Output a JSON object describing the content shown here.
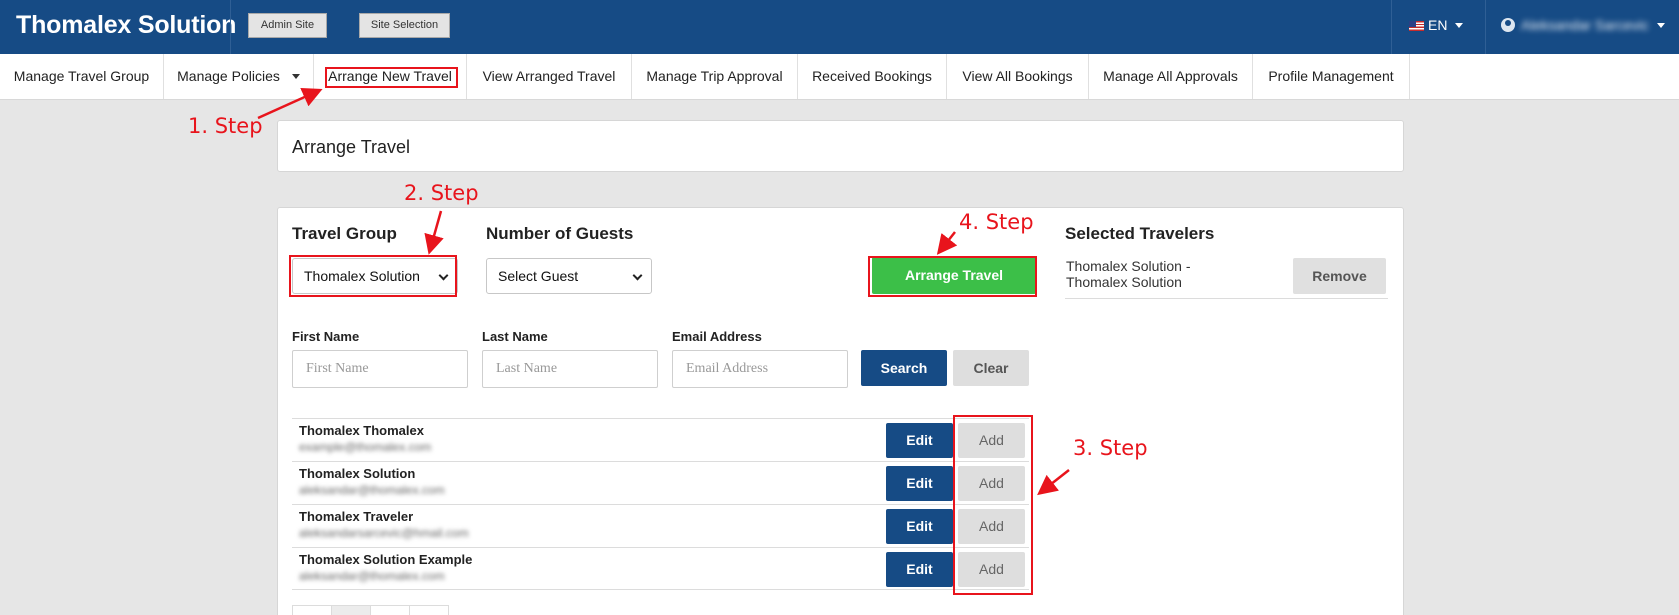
{
  "header": {
    "brand": "Thomalex Solution",
    "admin_site_label": "Admin Site",
    "site_selection_label": "Site Selection",
    "language": "EN",
    "user_name": "Aleksandar Sarcevic"
  },
  "nav": {
    "items": [
      "Manage Travel Group",
      "Manage Policies",
      "Arrange New Travel",
      "View Arranged Travel",
      "Manage Trip Approval",
      "Received Bookings",
      "View All Bookings",
      "Manage All Approvals",
      "Profile Management"
    ]
  },
  "page": {
    "title": "Arrange Travel"
  },
  "form": {
    "travel_group_heading": "Travel Group",
    "travel_group_value": "Thomalex Solution",
    "guests_heading": "Number of Guests",
    "guests_value": "Select Guest",
    "arrange_button": "Arrange Travel",
    "selected_heading": "Selected Travelers",
    "selected_item": "Thomalex Solution - Thomalex Solution",
    "remove_button": "Remove"
  },
  "search": {
    "first_name_label": "First Name",
    "first_name_placeholder": "First Name",
    "last_name_label": "Last Name",
    "last_name_placeholder": "Last Name",
    "email_label": "Email Address",
    "email_placeholder": "Email Address",
    "search_button": "Search",
    "clear_button": "Clear"
  },
  "travelers": [
    {
      "name": "Thomalex Thomalex",
      "email": "example@thomalex.com",
      "edit": "Edit",
      "add": "Add"
    },
    {
      "name": "Thomalex Solution",
      "email": "aleksandar@thomalex.com",
      "edit": "Edit",
      "add": "Add"
    },
    {
      "name": "Thomalex Traveler",
      "email": "aleksandarsarcevic@hmail.com",
      "edit": "Edit",
      "add": "Add"
    },
    {
      "name": "Thomalex Solution Example",
      "email": "aleksandar@thomalex.com",
      "edit": "Edit",
      "add": "Add"
    }
  ],
  "annotations": {
    "step1": "1. Step",
    "step2": "2. Step",
    "step3": "3. Step",
    "step4": "4. Step",
    "color": "#e8141c"
  },
  "colors": {
    "primary": "#164b85",
    "success": "#3cbf48",
    "neutral": "#dedede"
  }
}
